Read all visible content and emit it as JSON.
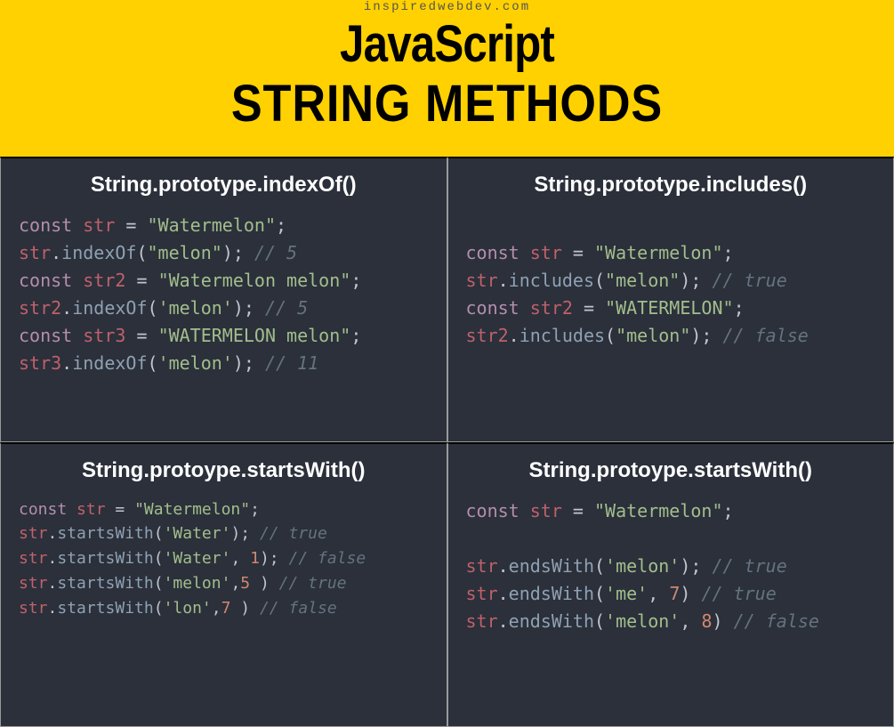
{
  "header": {
    "site": "inspiredwebdev.com",
    "title_line1": "JavaScript",
    "title_line2": "STRING METHODS"
  },
  "cells": [
    {
      "title": "String.prototype.indexOf()",
      "code_size": "big",
      "lines": [
        [
          {
            "cls": "kw",
            "t": "const"
          },
          {
            "cls": "op",
            "t": " "
          },
          {
            "cls": "var",
            "t": "str"
          },
          {
            "cls": "op",
            "t": " = "
          },
          {
            "cls": "str",
            "t": "\"Watermelon\""
          },
          {
            "cls": "op",
            "t": ";"
          }
        ],
        [
          {
            "cls": "var",
            "t": "str"
          },
          {
            "cls": "op",
            "t": "."
          },
          {
            "cls": "fn",
            "t": "indexOf"
          },
          {
            "cls": "op",
            "t": "("
          },
          {
            "cls": "str",
            "t": "\"melon\""
          },
          {
            "cls": "op",
            "t": "); "
          },
          {
            "cls": "cm",
            "t": "// 5"
          }
        ],
        [
          {
            "cls": "kw",
            "t": "const"
          },
          {
            "cls": "op",
            "t": " "
          },
          {
            "cls": "var",
            "t": "str2"
          },
          {
            "cls": "op",
            "t": " = "
          },
          {
            "cls": "str",
            "t": "\"Watermelon melon\""
          },
          {
            "cls": "op",
            "t": ";"
          }
        ],
        [
          {
            "cls": "var",
            "t": "str2"
          },
          {
            "cls": "op",
            "t": "."
          },
          {
            "cls": "fn",
            "t": "indexOf"
          },
          {
            "cls": "op",
            "t": "("
          },
          {
            "cls": "str",
            "t": "'melon'"
          },
          {
            "cls": "op",
            "t": "); "
          },
          {
            "cls": "cm",
            "t": "// 5"
          }
        ],
        [
          {
            "cls": "kw",
            "t": "const"
          },
          {
            "cls": "op",
            "t": " "
          },
          {
            "cls": "var",
            "t": "str3"
          },
          {
            "cls": "op",
            "t": " = "
          },
          {
            "cls": "str",
            "t": "\"WATERMELON melon\""
          },
          {
            "cls": "op",
            "t": ";"
          }
        ],
        [
          {
            "cls": "var",
            "t": "str3"
          },
          {
            "cls": "op",
            "t": "."
          },
          {
            "cls": "fn",
            "t": "indexOf"
          },
          {
            "cls": "op",
            "t": "("
          },
          {
            "cls": "str",
            "t": "'melon'"
          },
          {
            "cls": "op",
            "t": "); "
          },
          {
            "cls": "cm",
            "t": "// 11"
          }
        ]
      ]
    },
    {
      "title": "String.prototype.includes()",
      "code_size": "big",
      "lines": [
        [],
        [
          {
            "cls": "kw",
            "t": "const"
          },
          {
            "cls": "op",
            "t": " "
          },
          {
            "cls": "var",
            "t": "str"
          },
          {
            "cls": "op",
            "t": " = "
          },
          {
            "cls": "str",
            "t": "\"Watermelon\""
          },
          {
            "cls": "op",
            "t": ";"
          }
        ],
        [
          {
            "cls": "var",
            "t": "str"
          },
          {
            "cls": "op",
            "t": "."
          },
          {
            "cls": "fn",
            "t": "includes"
          },
          {
            "cls": "op",
            "t": "("
          },
          {
            "cls": "str",
            "t": "\"melon\""
          },
          {
            "cls": "op",
            "t": "); "
          },
          {
            "cls": "cm",
            "t": "// true"
          }
        ],
        [
          {
            "cls": "kw",
            "t": "const"
          },
          {
            "cls": "op",
            "t": " "
          },
          {
            "cls": "var",
            "t": "str2"
          },
          {
            "cls": "op",
            "t": " = "
          },
          {
            "cls": "str",
            "t": "\"WATERMELON\""
          },
          {
            "cls": "op",
            "t": ";"
          }
        ],
        [
          {
            "cls": "var",
            "t": "str2"
          },
          {
            "cls": "op",
            "t": "."
          },
          {
            "cls": "fn",
            "t": "includes"
          },
          {
            "cls": "op",
            "t": "("
          },
          {
            "cls": "str",
            "t": "\"melon\""
          },
          {
            "cls": "op",
            "t": "); "
          },
          {
            "cls": "cm",
            "t": "// false"
          }
        ]
      ]
    },
    {
      "title": "String.protoype.startsWith()",
      "code_size": "small",
      "lines": [
        [
          {
            "cls": "kw",
            "t": "const"
          },
          {
            "cls": "op",
            "t": " "
          },
          {
            "cls": "var",
            "t": "str"
          },
          {
            "cls": "op",
            "t": " = "
          },
          {
            "cls": "str",
            "t": "\"Watermelon\""
          },
          {
            "cls": "op",
            "t": ";"
          }
        ],
        [
          {
            "cls": "var",
            "t": "str"
          },
          {
            "cls": "op",
            "t": "."
          },
          {
            "cls": "fn",
            "t": "startsWith"
          },
          {
            "cls": "op",
            "t": "("
          },
          {
            "cls": "str",
            "t": "'Water'"
          },
          {
            "cls": "op",
            "t": "); "
          },
          {
            "cls": "cm",
            "t": "// true"
          }
        ],
        [
          {
            "cls": "var",
            "t": "str"
          },
          {
            "cls": "op",
            "t": "."
          },
          {
            "cls": "fn",
            "t": "startsWith"
          },
          {
            "cls": "op",
            "t": "("
          },
          {
            "cls": "str",
            "t": "'Water'"
          },
          {
            "cls": "op",
            "t": ", "
          },
          {
            "cls": "num",
            "t": "1"
          },
          {
            "cls": "op",
            "t": "); "
          },
          {
            "cls": "cm",
            "t": "// false"
          }
        ],
        [
          {
            "cls": "var",
            "t": "str"
          },
          {
            "cls": "op",
            "t": "."
          },
          {
            "cls": "fn",
            "t": "startsWith"
          },
          {
            "cls": "op",
            "t": "("
          },
          {
            "cls": "str",
            "t": "'melon'"
          },
          {
            "cls": "op",
            "t": ","
          },
          {
            "cls": "num",
            "t": "5"
          },
          {
            "cls": "op",
            "t": " ) "
          },
          {
            "cls": "cm",
            "t": "// true"
          }
        ],
        [
          {
            "cls": "var",
            "t": "str"
          },
          {
            "cls": "op",
            "t": "."
          },
          {
            "cls": "fn",
            "t": "startsWith"
          },
          {
            "cls": "op",
            "t": "("
          },
          {
            "cls": "str",
            "t": "'lon'"
          },
          {
            "cls": "op",
            "t": ","
          },
          {
            "cls": "num",
            "t": "7"
          },
          {
            "cls": "op",
            "t": " ) "
          },
          {
            "cls": "cm",
            "t": "// false"
          }
        ]
      ]
    },
    {
      "title": "String.protoype.startsWith()",
      "code_size": "big",
      "lines": [
        [
          {
            "cls": "kw",
            "t": "const"
          },
          {
            "cls": "op",
            "t": " "
          },
          {
            "cls": "var",
            "t": "str"
          },
          {
            "cls": "op",
            "t": " = "
          },
          {
            "cls": "str",
            "t": "\"Watermelon\""
          },
          {
            "cls": "op",
            "t": ";"
          }
        ],
        [],
        [
          {
            "cls": "var",
            "t": "str"
          },
          {
            "cls": "op",
            "t": "."
          },
          {
            "cls": "fn",
            "t": "endsWith"
          },
          {
            "cls": "op",
            "t": "("
          },
          {
            "cls": "str",
            "t": "'melon'"
          },
          {
            "cls": "op",
            "t": "); "
          },
          {
            "cls": "cm",
            "t": "// true"
          }
        ],
        [
          {
            "cls": "var",
            "t": "str"
          },
          {
            "cls": "op",
            "t": "."
          },
          {
            "cls": "fn",
            "t": "endsWith"
          },
          {
            "cls": "op",
            "t": "("
          },
          {
            "cls": "str",
            "t": "'me'"
          },
          {
            "cls": "op",
            "t": ", "
          },
          {
            "cls": "num",
            "t": "7"
          },
          {
            "cls": "op",
            "t": ") "
          },
          {
            "cls": "cm",
            "t": "// true"
          }
        ],
        [
          {
            "cls": "var",
            "t": "str"
          },
          {
            "cls": "op",
            "t": "."
          },
          {
            "cls": "fn",
            "t": "endsWith"
          },
          {
            "cls": "op",
            "t": "("
          },
          {
            "cls": "str",
            "t": "'melon'"
          },
          {
            "cls": "op",
            "t": ", "
          },
          {
            "cls": "num",
            "t": "8"
          },
          {
            "cls": "op",
            "t": ") "
          },
          {
            "cls": "cm",
            "t": "// false"
          }
        ]
      ]
    }
  ]
}
